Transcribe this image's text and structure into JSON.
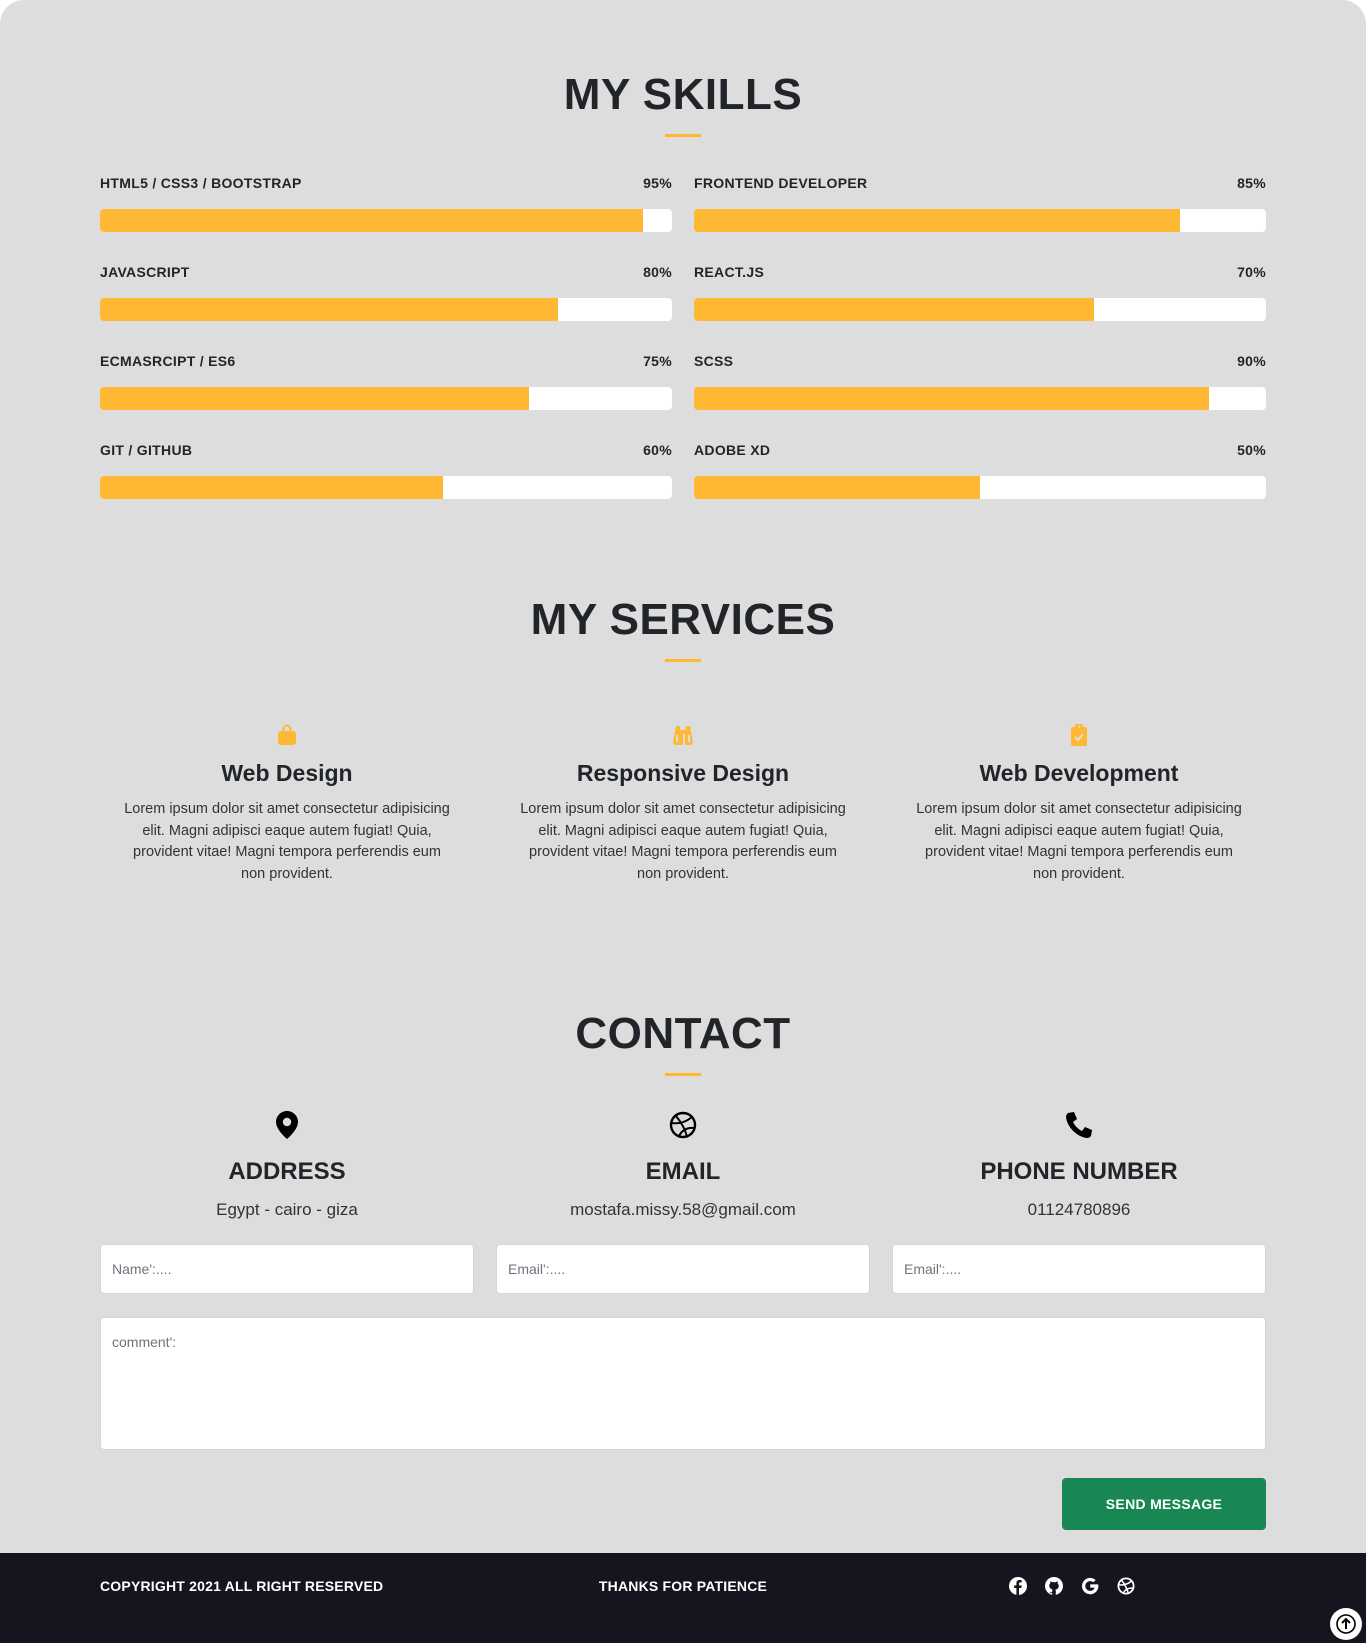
{
  "colors": {
    "accent": "#ffb833",
    "page_bg": "#dddddd",
    "footer_bg": "#15151f",
    "button_bg": "#198754"
  },
  "skills": {
    "title": "MY SKILLS",
    "items": [
      {
        "name": "HTML5 / CSS3 / BOOTSTRAP",
        "percent_label": "95%",
        "level": 95
      },
      {
        "name": "FRONTEND DEVELOPER",
        "percent_label": "85%",
        "level": 85
      },
      {
        "name": "JAVASCRIPT",
        "percent_label": "80%",
        "level": 80
      },
      {
        "name": "REACT.JS",
        "percent_label": "70%",
        "level": 70
      },
      {
        "name": "ECMASRCIPT / ES6",
        "percent_label": "75%",
        "level": 75
      },
      {
        "name": "SCSS",
        "percent_label": "90%",
        "level": 90
      },
      {
        "name": "GIT / GITHUB",
        "percent_label": "60%",
        "level": 60
      },
      {
        "name": "ADOBE XD",
        "percent_label": "50%",
        "level": 50
      }
    ]
  },
  "services": {
    "title": "MY SERVICES",
    "items": [
      {
        "icon": "shopping-bag-icon",
        "title": "Web Design",
        "text": "Lorem ipsum dolor sit amet consectetur adipisicing elit. Magni adipisci eaque autem fugiat! Quia, provident vitae! Magni tempora perferendis eum non provident."
      },
      {
        "icon": "binoculars-icon",
        "title": "Responsive Design",
        "text": "Lorem ipsum dolor sit amet consectetur adipisicing elit. Magni adipisci eaque autem fugiat! Quia, provident vitae! Magni tempora perferendis eum non provident."
      },
      {
        "icon": "clipboard-check-icon",
        "title": "Web Development",
        "text": "Lorem ipsum dolor sit amet consectetur adipisicing elit. Magni adipisci eaque autem fugiat! Quia, provident vitae! Magni tempora perferendis eum non provident."
      }
    ]
  },
  "contact": {
    "title": "CONTACT",
    "items": [
      {
        "icon": "map-pin-icon",
        "title": "ADDRESS",
        "value": "Egypt - cairo - giza"
      },
      {
        "icon": "dribbble-icon",
        "title": "EMAIL",
        "value": "mostafa.missy.58@gmail.com"
      },
      {
        "icon": "phone-icon",
        "title": "PHONE NUMBER",
        "value": "01124780896"
      }
    ],
    "form": {
      "name_placeholder": "Name':....",
      "email_placeholder": "Email':....",
      "email2_placeholder": "Email':....",
      "comment_placeholder": "comment':",
      "send_label": "SEND MESSAGE"
    }
  },
  "footer": {
    "copyright": "COPYRIGHT 2021 ALL RIGHT RESERVED",
    "thanks": "THANKS FOR PATIENCE",
    "social": [
      "facebook-icon",
      "github-icon",
      "google-icon",
      "dribbble-icon"
    ],
    "scroll_top_icon": "arrow-up-icon"
  }
}
